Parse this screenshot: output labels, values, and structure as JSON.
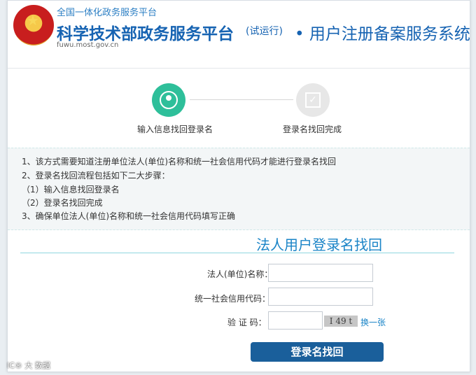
{
  "header": {
    "top_small": "全国一体化政务服务平台",
    "title_main": "科学技术部政务服务平台",
    "title_tag": "(试运行)",
    "title_sub": "• 用户注册备案服务系统",
    "site_url": "fuwu.most.gov.cn",
    "emblem_icon": "national-emblem-icon"
  },
  "steps": [
    {
      "label": "输入信息找回登录名",
      "icon": "user-icon",
      "status": "active",
      "color": "#2ebf9a"
    },
    {
      "label": "登录名找回完成",
      "icon": "checkbox-icon",
      "status": "inactive",
      "color": "#e7e7e7"
    }
  ],
  "instructions": [
    "1、该方式需要知道注册单位法人(单位)名称和统一社会信用代码才能进行登录名找回",
    "2、登录名找回流程包括如下二大步骤：",
    "（1）输入信息找回登录名",
    "（2）登录名找回完成",
    "3、确保单位法人(单位)名称和统一社会信用代码填写正确"
  ],
  "form": {
    "title": "法人用户登录名找回",
    "fields": [
      {
        "label": "法人(单位)名称：",
        "value": ""
      },
      {
        "label": "统一社会信用代码：",
        "value": ""
      },
      {
        "label": "验 证 码：",
        "value": ""
      }
    ],
    "captcha_text": "I 49 t",
    "refresh_label": "换一张",
    "submit_label": "登录名找回"
  },
  "watermark": "IC® 大 数据",
  "colors": {
    "accent": "#1a84c7",
    "title": "#1663b2",
    "button": "#1a5f9b",
    "step_active": "#2ebf9a"
  }
}
